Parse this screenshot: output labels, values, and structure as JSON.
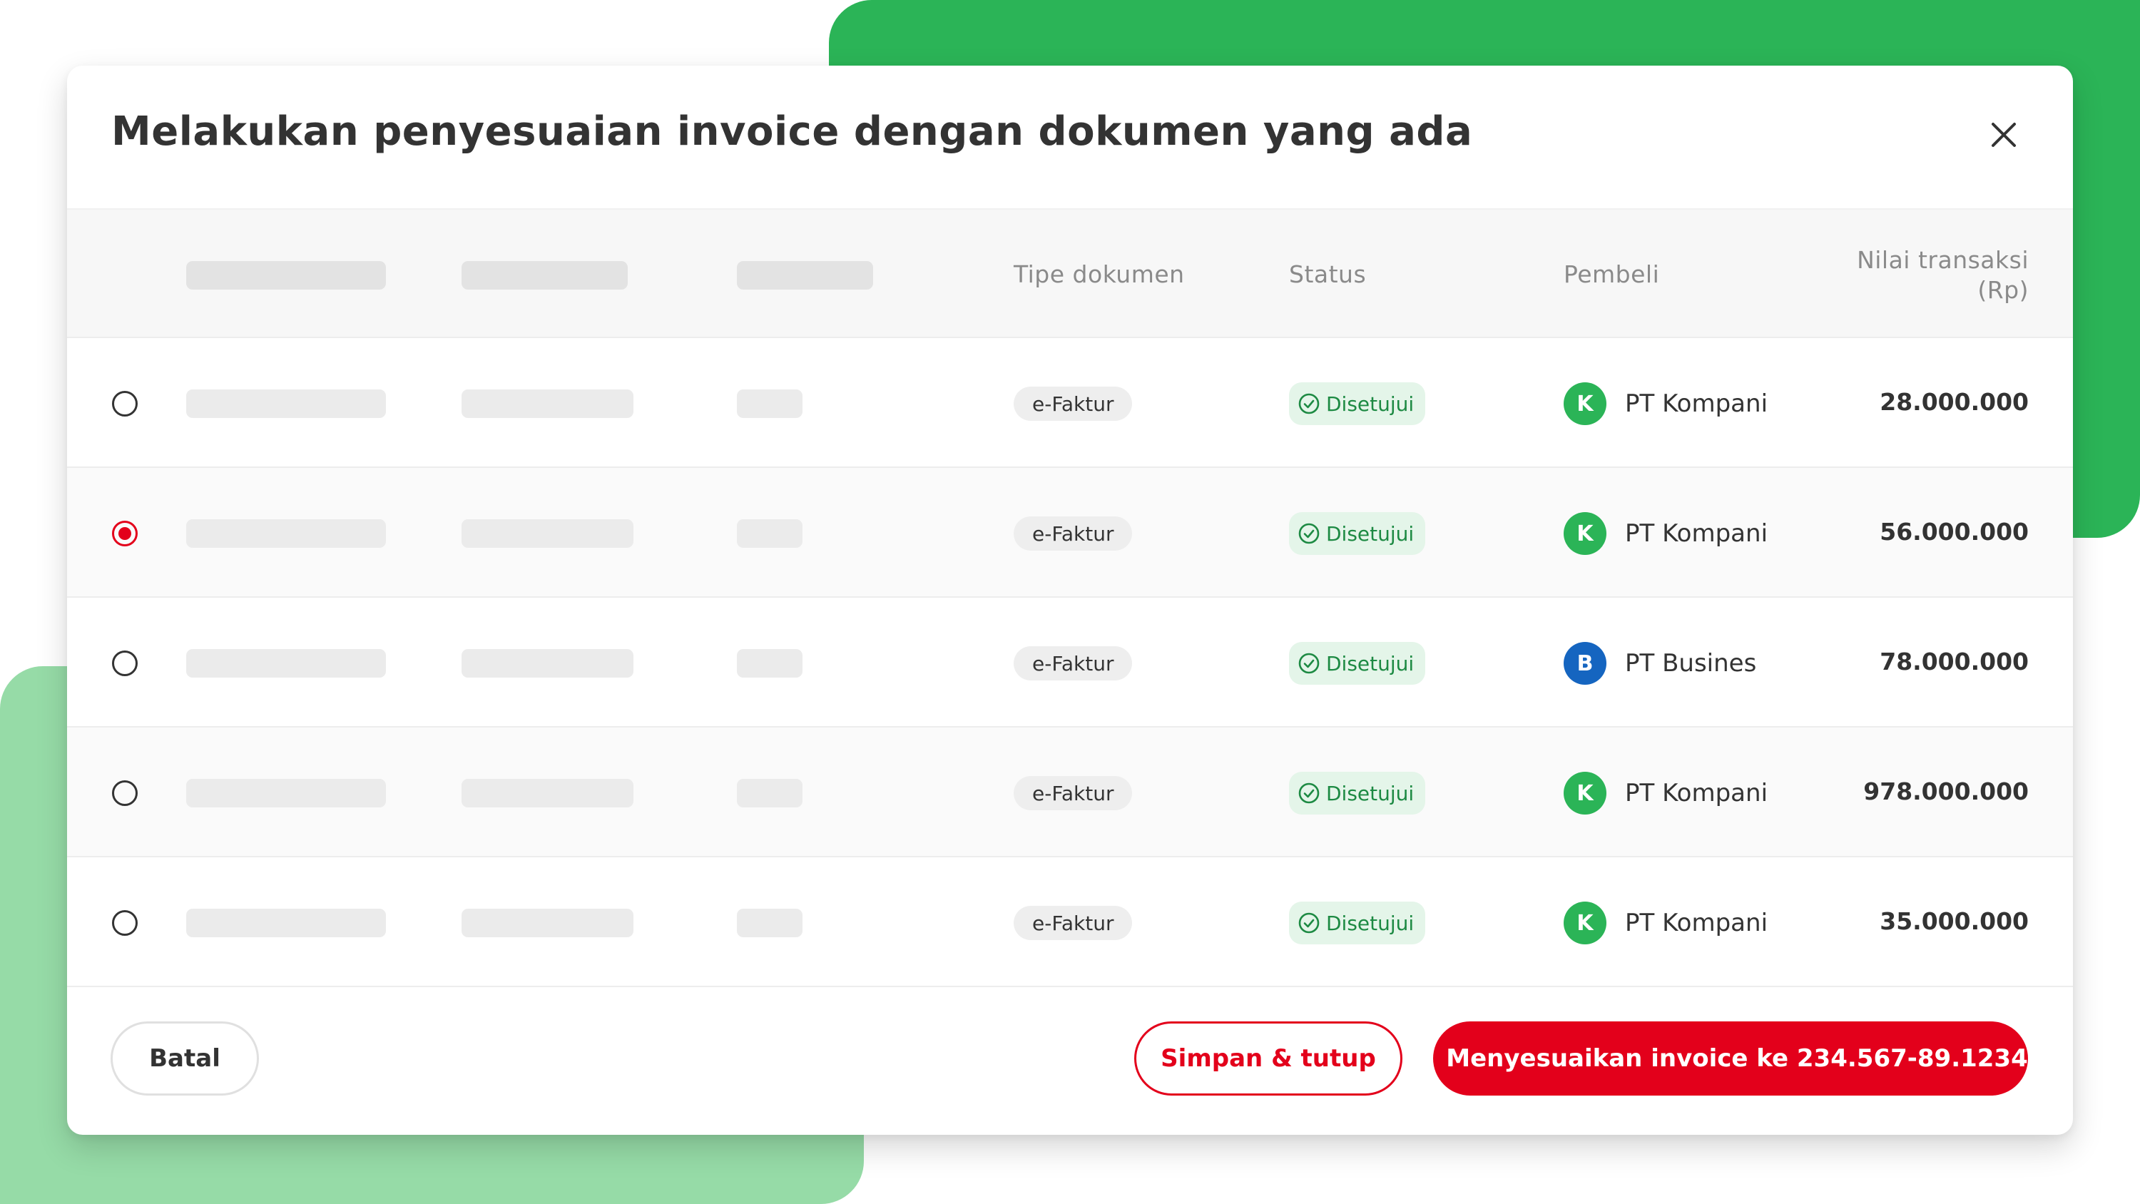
{
  "colors": {
    "accent_red": "#e3001b",
    "status_green": "#1d8a43",
    "status_bg": "#e4f5e9",
    "avatar_green": "#2bb457",
    "avatar_blue": "#1565c0",
    "bg_green_dark": "#2bb457",
    "bg_green_light": "#96dba7"
  },
  "modal": {
    "title": "Melakukan penyesuaian invoice dengan dokumen yang ada",
    "close_icon": "close-icon"
  },
  "table": {
    "headers": {
      "doc_type": "Tipe dokumen",
      "status": "Status",
      "buyer": "Pembeli",
      "amount_line1": "Nilai transaksi",
      "amount_line2": "(Rp)"
    },
    "rows": [
      {
        "selected": false,
        "doc_type": "e-Faktur",
        "status": "Disetujui",
        "avatar": "K",
        "avatar_color": "green",
        "buyer": "PT Kompani",
        "amount": "28.000.000"
      },
      {
        "selected": true,
        "doc_type": "e-Faktur",
        "status": "Disetujui",
        "avatar": "K",
        "avatar_color": "green",
        "buyer": "PT Kompani",
        "amount": "56.000.000"
      },
      {
        "selected": false,
        "doc_type": "e-Faktur",
        "status": "Disetujui",
        "avatar": "B",
        "avatar_color": "blue",
        "buyer": "PT Busines",
        "amount": "78.000.000"
      },
      {
        "selected": false,
        "doc_type": "e-Faktur",
        "status": "Disetujui",
        "avatar": "K",
        "avatar_color": "green",
        "buyer": "PT Kompani",
        "amount": "978.000.000"
      },
      {
        "selected": false,
        "doc_type": "e-Faktur",
        "status": "Disetujui",
        "avatar": "K",
        "avatar_color": "green",
        "buyer": "PT Kompani",
        "amount": "35.000.000"
      }
    ]
  },
  "footer": {
    "cancel_label": "Batal",
    "save_label": "Simpan & tutup",
    "primary_label": "Menyesuaikan invoice ke 234.567-89.1234",
    "primary_icon": "link-icon"
  }
}
